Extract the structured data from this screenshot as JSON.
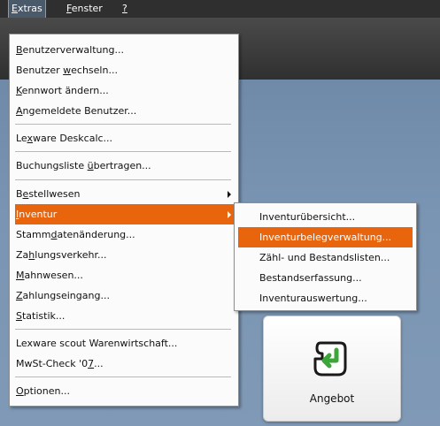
{
  "menubar": {
    "items": [
      {
        "pre": "",
        "acc": "E",
        "post": "xtras"
      },
      {
        "pre": "",
        "acc": "F",
        "post": "enster"
      },
      {
        "pre": "",
        "acc": "?",
        "post": ""
      }
    ]
  },
  "extras_menu": {
    "items": [
      {
        "pre": "",
        "acc": "B",
        "post": "enutzerverwaltung..."
      },
      {
        "pre": "Benutzer ",
        "acc": "w",
        "post": "echseln..."
      },
      {
        "pre": "",
        "acc": "K",
        "post": "ennwort ändern..."
      },
      {
        "pre": "",
        "acc": "A",
        "post": "ngemeldete Benutzer..."
      },
      {
        "pre": "Le",
        "acc": "x",
        "post": "ware Deskcalc..."
      },
      {
        "pre": "Buchungsliste ",
        "acc": "ü",
        "post": "bertragen..."
      },
      {
        "pre": "B",
        "acc": "e",
        "post": "stellwesen"
      },
      {
        "pre": "",
        "acc": "I",
        "post": "nventur"
      },
      {
        "pre": "Stamm",
        "acc": "d",
        "post": "atenänderung..."
      },
      {
        "pre": "Za",
        "acc": "h",
        "post": "lungsverkehr..."
      },
      {
        "pre": "",
        "acc": "M",
        "post": "ahnwesen..."
      },
      {
        "pre": "",
        "acc": "Z",
        "post": "ahlungseingang..."
      },
      {
        "pre": "",
        "acc": "S",
        "post": "tatistik..."
      },
      {
        "pre": "Lexware scout Warenwirtschaft...",
        "acc": "",
        "post": ""
      },
      {
        "pre": "MwSt-Check '0",
        "acc": "7",
        "post": "..."
      },
      {
        "pre": "",
        "acc": "O",
        "post": "ptionen..."
      }
    ]
  },
  "inventur_submenu": {
    "items": [
      {
        "pre": "Inventur",
        "acc": "ü",
        "post": "bersicht..."
      },
      {
        "pre": "",
        "acc": "I",
        "post": "nventurbelegverwaltung..."
      },
      {
        "pre": "Zähl- und Bestands",
        "acc": "l",
        "post": "isten..."
      },
      {
        "pre": "Bestands",
        "acc": "e",
        "post": "rfassung..."
      },
      {
        "pre": "Inventur",
        "acc": "a",
        "post": "uswertung..."
      }
    ]
  },
  "tile": {
    "label": "Angebot"
  },
  "colors": {
    "highlight": "#e8650e",
    "menubar": "#2f2f2f",
    "desktop": "#7a95b3"
  }
}
